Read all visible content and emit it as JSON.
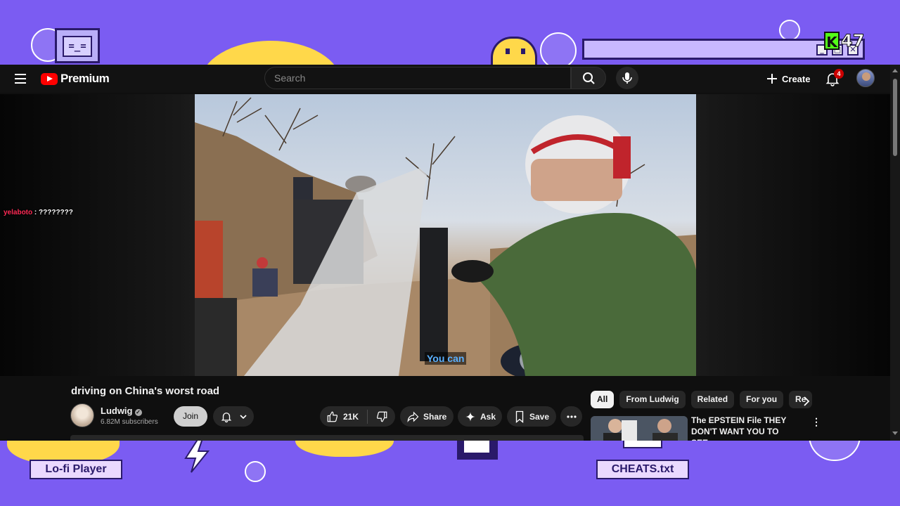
{
  "overlay": {
    "tv_face": "=_=",
    "counter": "47",
    "counter_k": "K",
    "label_left": "Lo-fi Player",
    "label_right": "CHEATS.txt",
    "window_controls": [
      "_",
      "□",
      "✕"
    ]
  },
  "chat": {
    "username": "yelaboto",
    "separator": " : ",
    "message": "????????"
  },
  "header": {
    "logo_text": "Premium",
    "search_placeholder": "Search",
    "create_label": "Create",
    "notification_count": "4"
  },
  "video": {
    "caption": "You can",
    "title": "driving on China's worst road"
  },
  "channel": {
    "name": "Ludwig",
    "subscribers": "6.82M subscribers",
    "join_label": "Join"
  },
  "actions": {
    "like_count": "21K",
    "share_label": "Share",
    "ask_label": "Ask",
    "save_label": "Save"
  },
  "chips": [
    "All",
    "From Ludwig",
    "Related",
    "For you",
    "Re"
  ],
  "related": {
    "title": "The EPSTEIN File THEY DON'T WANT YOU TO SEE..."
  },
  "colors": {
    "overlay_bg": "#7b5cf2",
    "accent_yellow": "#ffd84a",
    "youtube_red": "#ff0000",
    "kick_green": "#53fc18",
    "caption_blue": "#5ab0ff"
  }
}
